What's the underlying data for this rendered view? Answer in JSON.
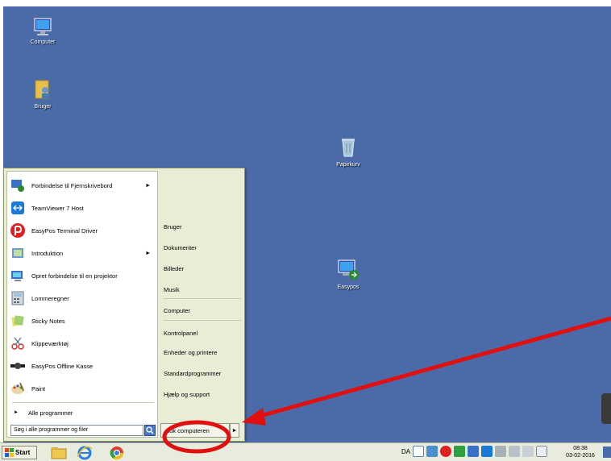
{
  "desktop": {
    "icons": {
      "computer": "Computer",
      "bruger": "Bruger",
      "papirkurv": "Papirkurv",
      "easypos": "Easypos"
    }
  },
  "start_menu": {
    "programs": [
      {
        "label": "Forbindelse til Fjernskrivebord",
        "has_submenu": true
      },
      {
        "label": "TeamViewer 7 Host"
      },
      {
        "label": "EasyPos Terminal Driver"
      },
      {
        "label": "Introduktion",
        "has_submenu": true
      },
      {
        "label": "Opret forbindelse til en projektor"
      },
      {
        "label": "Lommeregner"
      },
      {
        "label": "Sticky Notes"
      },
      {
        "label": "Klippeværktøj"
      },
      {
        "label": "EasyPos Offline Kasse"
      },
      {
        "label": "Paint"
      }
    ],
    "all_programs": "Alle programmer",
    "search_placeholder": "Søg i alle programmer og filer",
    "right_items": [
      "Bruger",
      "Dokumenter",
      "Billeder",
      "Musik",
      "Computer",
      "Kontrolpanel",
      "Enheder og printere",
      "Standardprogrammer",
      "Hjælp og support"
    ],
    "shutdown": "Luk computeren"
  },
  "taskbar": {
    "start": "Start",
    "language": "DA",
    "time": "08:38",
    "date": "03-02-2016"
  },
  "colors": {
    "desktop": "#4a6aa8",
    "annotation": "#e01010"
  }
}
